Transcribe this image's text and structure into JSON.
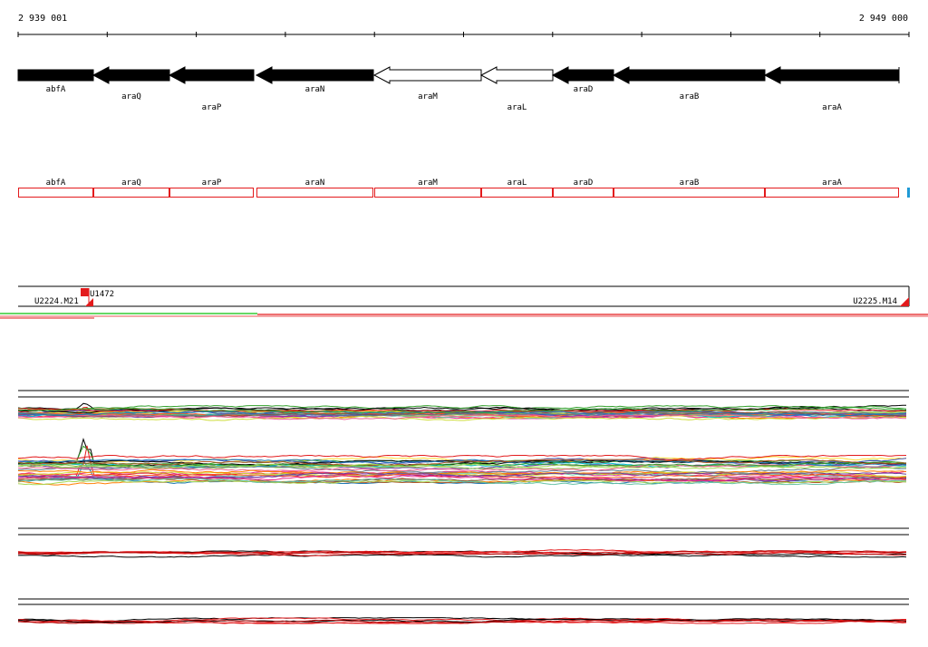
{
  "coordinates": {
    "start": "2 939 001",
    "end": "2 949 000"
  },
  "genes": [
    {
      "name": "abfA",
      "filled": true,
      "dir": "right"
    },
    {
      "name": "araQ",
      "filled": true,
      "dir": "left"
    },
    {
      "name": "araP",
      "filled": true,
      "dir": "left"
    },
    {
      "name": "araN",
      "filled": true,
      "dir": "left"
    },
    {
      "name": "araM",
      "filled": false,
      "dir": "left"
    },
    {
      "name": "araL",
      "filled": false,
      "dir": "left"
    },
    {
      "name": "araD",
      "filled": true,
      "dir": "left"
    },
    {
      "name": "araB",
      "filled": true,
      "dir": "left"
    },
    {
      "name": "araA",
      "filled": true,
      "dir": "left"
    }
  ],
  "promoters": {
    "left_label": "U2224.M21",
    "left_marker": "U1472",
    "right_label": "U2225.M14"
  },
  "colors": {
    "gene_fill": "#000000",
    "region_outline": "#e31a1c",
    "accent_blue": "#1f9ad6",
    "track_green": "#33cc33",
    "track_red": "#e31a1c"
  }
}
